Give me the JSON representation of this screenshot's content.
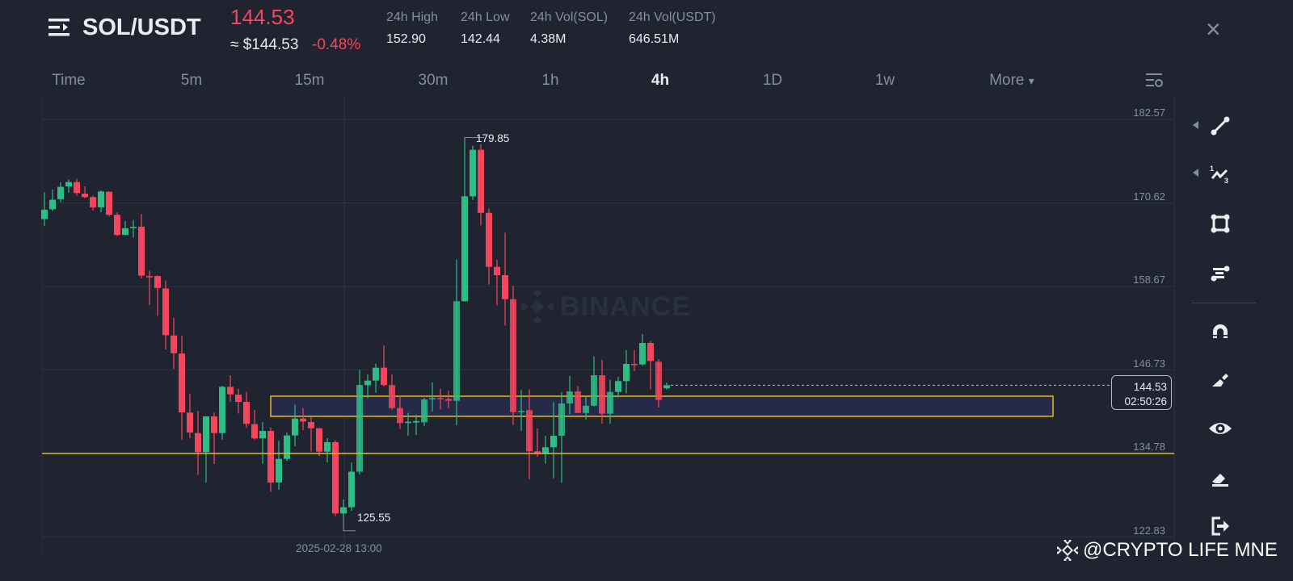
{
  "header": {
    "pair": "SOL/USDT",
    "last_price": "144.53",
    "usd_price": "≈ $144.53",
    "change_pct": "-0.48%",
    "stats": [
      {
        "label": "24h High",
        "value": "152.90"
      },
      {
        "label": "24h Low",
        "value": "142.44"
      },
      {
        "label": "24h Vol(SOL)",
        "value": "4.38M"
      },
      {
        "label": "24h Vol(USDT)",
        "value": "646.51M"
      }
    ],
    "close_icon": "×"
  },
  "timeframes": {
    "items": [
      "Time",
      "5m",
      "15m",
      "30m",
      "1h",
      "4h",
      "1D",
      "1w",
      "More"
    ],
    "active": "4h",
    "more_icon": "▾"
  },
  "colors": {
    "up": "#2ebd85",
    "down": "#f6465d",
    "accent": "#f0b90b",
    "zone_fill": "#252b4a"
  },
  "watermark": {
    "logo_text": "BINANCE",
    "credit": "@CRYPTO LIFE MNE"
  },
  "chart_data": {
    "type": "candlestick",
    "symbol": "SOL/USDT",
    "interval": "4h",
    "y_ticks": [
      "182.57",
      "170.62",
      "158.67",
      "146.73",
      "134.78",
      "122.83"
    ],
    "ylim": [
      122.83,
      182.57
    ],
    "x_label": "2025-02-28 13:00",
    "current_price": "144.53",
    "countdown": "02:50:26",
    "high_marker": "179.85",
    "low_marker": "125.55",
    "horizontal_line": 134.78,
    "zone": {
      "top": 142.96,
      "bottom": 140.08
    },
    "ohlc": [
      [
        168.3,
        169.65,
        172.15,
        167.34
      ],
      [
        169.72,
        171.07,
        172.53,
        169.45
      ],
      [
        171.15,
        172.92,
        173.57,
        170.72
      ],
      [
        172.99,
        173.61,
        173.99,
        172.07
      ],
      [
        173.61,
        172.03,
        174.07,
        171.65
      ],
      [
        171.95,
        171.45,
        172.99,
        171.3
      ],
      [
        171.45,
        169.99,
        171.65,
        169.53
      ],
      [
        169.99,
        172.26,
        172.42,
        169.3
      ],
      [
        172.22,
        168.92,
        172.26,
        168.68
      ],
      [
        168.92,
        166.03,
        169.26,
        165.88
      ],
      [
        166.03,
        166.99,
        168.03,
        166.03
      ],
      [
        167.15,
        167.2,
        168.19,
        165.68
      ],
      [
        167.22,
        160.22,
        169.03,
        159.8
      ],
      [
        160.15,
        160.1,
        160.92,
        156.0
      ],
      [
        160.15,
        158.45,
        160.26,
        154.45
      ],
      [
        158.38,
        151.69,
        159.53,
        149.65
      ],
      [
        151.65,
        149.11,
        154.18,
        146.84
      ],
      [
        149.07,
        140.65,
        151.65,
        136.76
      ],
      [
        140.61,
        137.76,
        143.3,
        136.95
      ],
      [
        137.68,
        134.95,
        140.88,
        131.68
      ],
      [
        134.95,
        140.07,
        140.1,
        130.61
      ],
      [
        140.07,
        137.68,
        140.61,
        133.26
      ],
      [
        137.68,
        144.3,
        144.45,
        136.76
      ],
      [
        144.3,
        143.22,
        145.95,
        142.15
      ],
      [
        143.18,
        142.15,
        144.03,
        140.49
      ],
      [
        142.15,
        139.0,
        143.57,
        138.42
      ],
      [
        138.96,
        136.92,
        140.99,
        136.76
      ],
      [
        136.92,
        137.99,
        139.26,
        133.3
      ],
      [
        137.99,
        130.61,
        138.49,
        129.26
      ],
      [
        130.61,
        133.99,
        136.57,
        129.57
      ],
      [
        133.99,
        137.34,
        137.8,
        133.68
      ],
      [
        137.34,
        139.76,
        141.76,
        135.8
      ],
      [
        139.76,
        139.34,
        141.26,
        138.11
      ],
      [
        139.26,
        138.38,
        140.03,
        135.03
      ],
      [
        138.38,
        135.03,
        138.38,
        134.38
      ],
      [
        135.03,
        136.38,
        136.95,
        133.49
      ],
      [
        136.38,
        126.18,
        136.65,
        125.8
      ],
      [
        126.18,
        127.07,
        128.18,
        125.55
      ],
      [
        127.07,
        132.15,
        133.49,
        126.57
      ],
      [
        132.15,
        144.57,
        146.76,
        131.76
      ],
      [
        144.56,
        145.19,
        146.08,
        142.69
      ],
      [
        145.19,
        147.04,
        147.62,
        143.46
      ],
      [
        147.04,
        144.56,
        150.2,
        144.37
      ],
      [
        144.56,
        141.27,
        146.08,
        141.04
      ],
      [
        141.27,
        139.11,
        143.08,
        138.27
      ],
      [
        139.2,
        139.3,
        140.58,
        137.3
      ],
      [
        139.2,
        139.4,
        140.3,
        137.4
      ],
      [
        139.23,
        142.5,
        142.7,
        138.65
      ],
      [
        142.6,
        142.7,
        144.92,
        140.77
      ],
      [
        142.7,
        142.57,
        144.03,
        141.08
      ],
      [
        142.57,
        142.3,
        143.73,
        141.27
      ],
      [
        142.3,
        156.55,
        162.51,
        138.77
      ],
      [
        156.55,
        171.56,
        179.85,
        156.5
      ],
      [
        171.56,
        178.22,
        178.8,
        171.06
      ],
      [
        178.22,
        169.21,
        179.0,
        167.4
      ],
      [
        169.21,
        161.47,
        169.8,
        158.93
      ],
      [
        161.47,
        160.28,
        162.5,
        155.97
      ],
      [
        160.28,
        156.85,
        166.36,
        153.08
      ],
      [
        156.85,
        140.69,
        158.74,
        138.84
      ],
      [
        140.69,
        140.85,
        143.84,
        138.0
      ],
      [
        140.96,
        135.07,
        143.92,
        131.07
      ],
      [
        135.07,
        134.68,
        138.34,
        134.3
      ],
      [
        134.68,
        135.65,
        137.3,
        133.3
      ],
      [
        135.65,
        137.3,
        142.12,
        131.22
      ],
      [
        137.3,
        141.92,
        143.57,
        130.61
      ],
      [
        141.92,
        143.65,
        145.85,
        140.38
      ],
      [
        143.65,
        140.57,
        144.42,
        140.57
      ],
      [
        140.57,
        141.6,
        142.88,
        139.61
      ],
      [
        141.6,
        145.96,
        148.66,
        141.5
      ],
      [
        145.96,
        140.46,
        148.16,
        139.03
      ],
      [
        140.46,
        143.57,
        145.31,
        139.03
      ],
      [
        143.57,
        145.12,
        145.7,
        142.77
      ],
      [
        145.12,
        147.58,
        149.54,
        143.38
      ],
      [
        147.58,
        147.42,
        149.54,
        146.54
      ],
      [
        147.5,
        150.58,
        151.85,
        147.3
      ],
      [
        150.58,
        148.0,
        150.85,
        143.92
      ],
      [
        147.9,
        142.42,
        148.27,
        141.35
      ],
      [
        144.1,
        144.53,
        144.9,
        143.9
      ]
    ]
  }
}
